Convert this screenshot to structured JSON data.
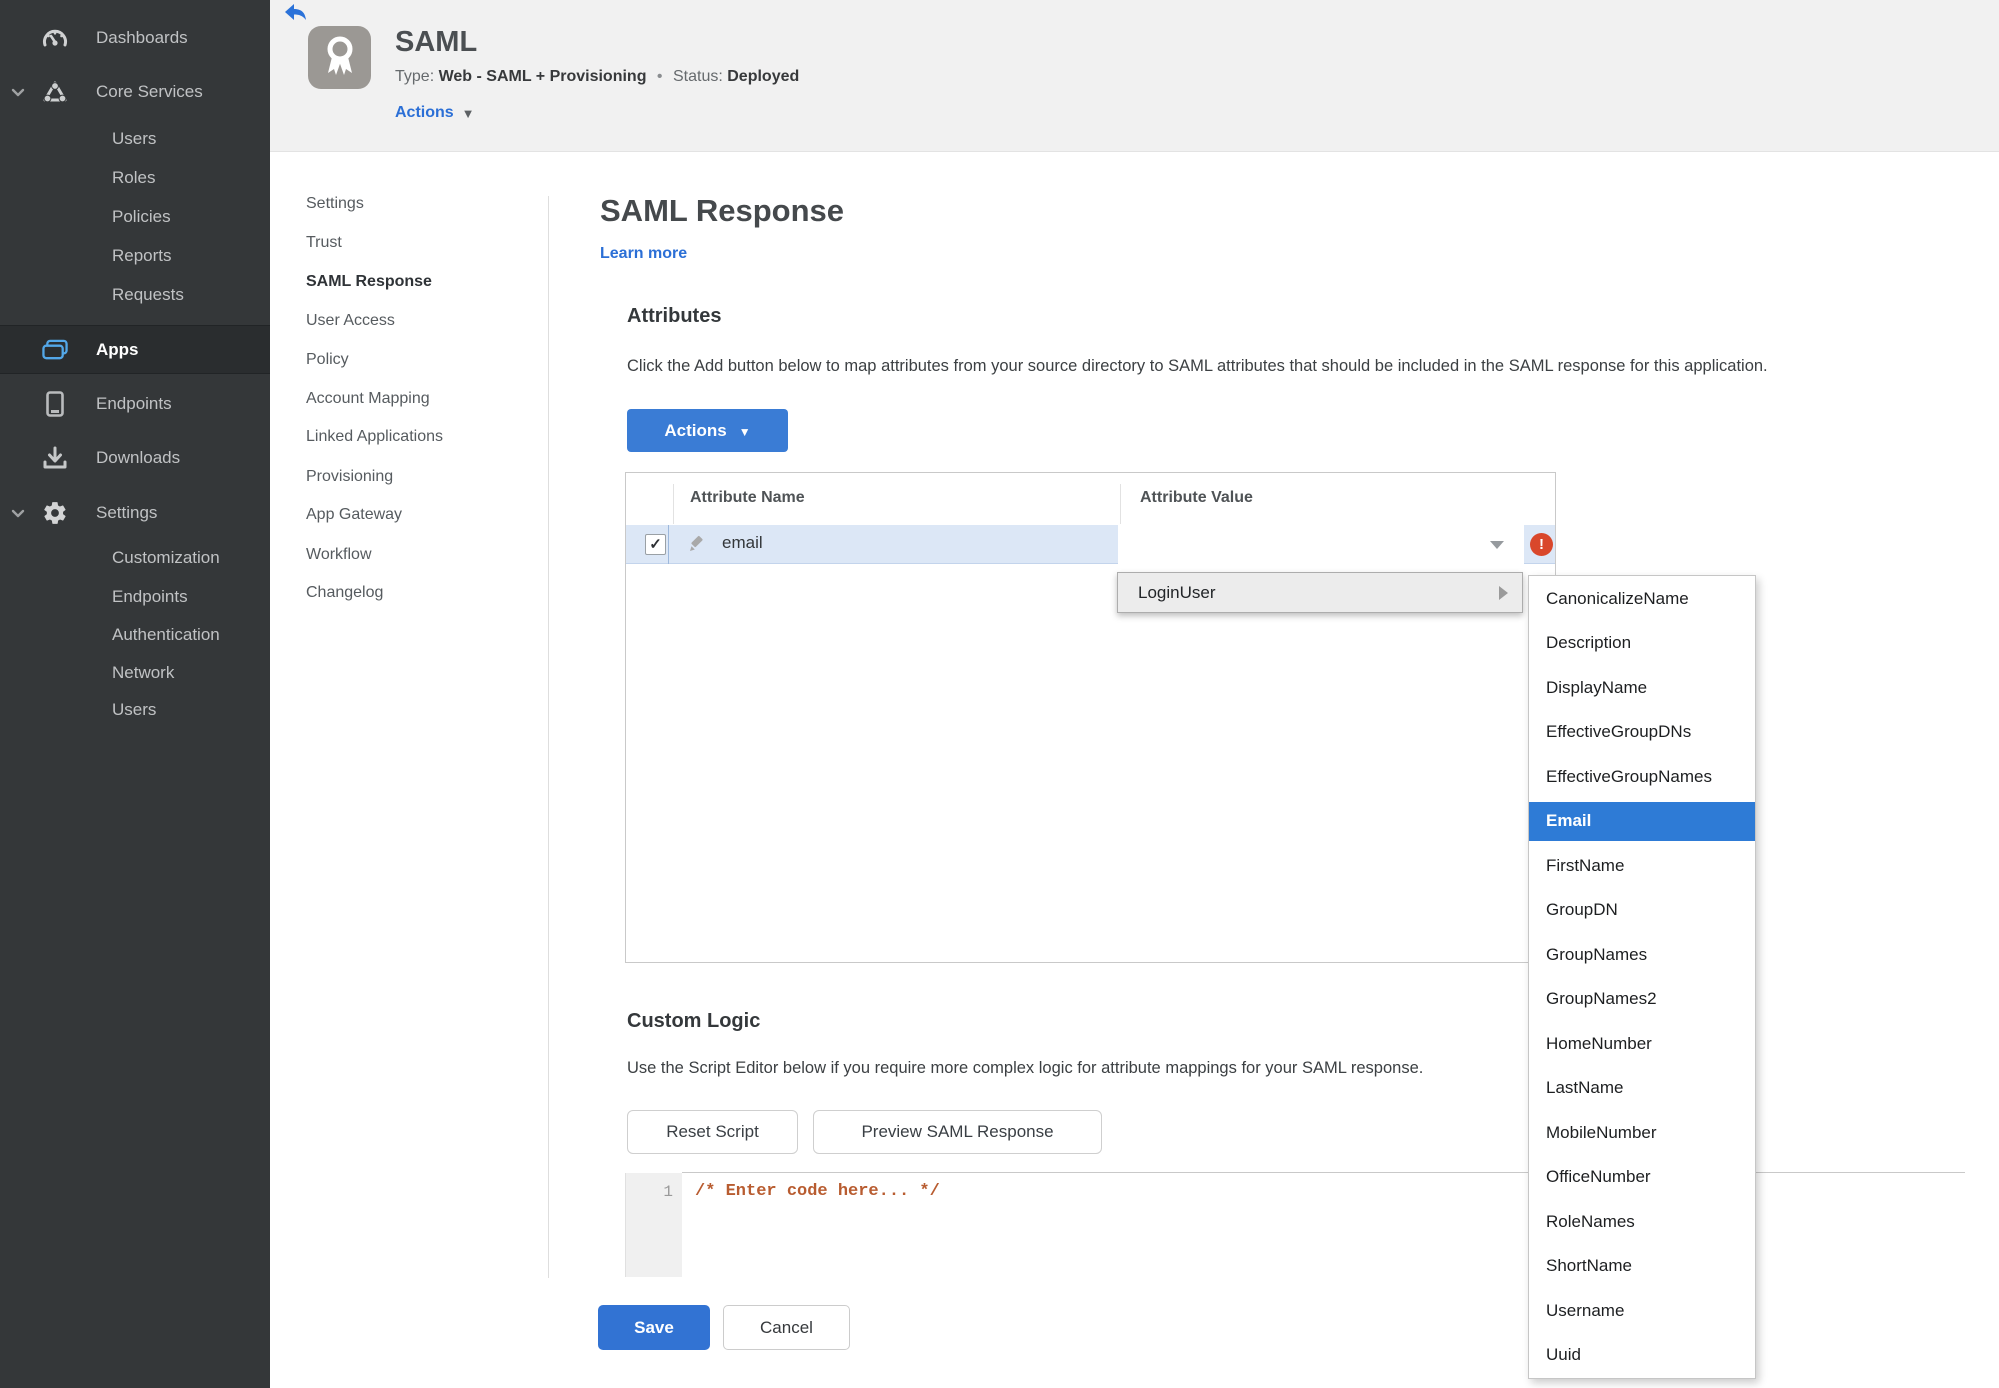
{
  "sidebar": {
    "items": [
      {
        "label": "Dashboards"
      },
      {
        "label": "Core Services"
      },
      {
        "label": "Users"
      },
      {
        "label": "Roles"
      },
      {
        "label": "Policies"
      },
      {
        "label": "Reports"
      },
      {
        "label": "Requests"
      },
      {
        "label": "Apps"
      },
      {
        "label": "Endpoints"
      },
      {
        "label": "Downloads"
      },
      {
        "label": "Settings"
      },
      {
        "label": "Customization"
      },
      {
        "label": "Endpoints"
      },
      {
        "label": "Authentication"
      },
      {
        "label": "Network"
      },
      {
        "label": "Users"
      }
    ]
  },
  "header": {
    "app_title": "SAML",
    "type_label": "Type:",
    "type_value": "Web - SAML + Provisioning",
    "separator": "•",
    "status_label": "Status:",
    "status_value": "Deployed",
    "actions_label": "Actions"
  },
  "nav": {
    "items": [
      {
        "label": "Settings"
      },
      {
        "label": "Trust"
      },
      {
        "label": "SAML Response"
      },
      {
        "label": "User Access"
      },
      {
        "label": "Policy"
      },
      {
        "label": "Account Mapping"
      },
      {
        "label": "Linked Applications"
      },
      {
        "label": "Provisioning"
      },
      {
        "label": "App Gateway"
      },
      {
        "label": "Workflow"
      },
      {
        "label": "Changelog"
      }
    ],
    "active": "SAML Response"
  },
  "main": {
    "title": "SAML Response",
    "learn_more": "Learn more",
    "attributes": {
      "heading": "Attributes",
      "description": "Click the Add button below to map attributes from your source directory to SAML attributes that should be included in the SAML response for this application.",
      "actions_button": "Actions",
      "table": {
        "columns": [
          "Attribute Name",
          "Attribute Value"
        ],
        "rows": [
          {
            "name": "email",
            "value": "",
            "checked": true,
            "error": true
          }
        ]
      }
    },
    "custom_logic": {
      "heading": "Custom Logic",
      "description": "Use the Script Editor below if you require more complex logic for attribute mappings for your SAML response.",
      "reset_button": "Reset Script",
      "preview_button": "Preview SAML Response",
      "editor": {
        "line_number": "1",
        "code": "/* Enter code here... */"
      }
    },
    "save_button": "Save",
    "cancel_button": "Cancel"
  },
  "dropdown": {
    "menu_label": "LoginUser",
    "submenu": {
      "items": [
        "CanonicalizeName",
        "Description",
        "DisplayName",
        "EffectiveGroupDNs",
        "EffectiveGroupNames",
        "Email",
        "FirstName",
        "GroupDN",
        "GroupNames",
        "GroupNames2",
        "HomeNumber",
        "LastName",
        "MobileNumber",
        "OfficeNumber",
        "RoleNames",
        "ShortName",
        "Username",
        "Uuid"
      ],
      "selected": "Email"
    }
  },
  "icons": {
    "caret_down": "▼",
    "check": "✓",
    "error_mark": "!"
  },
  "colors": {
    "accent_blue": "#3a7cd5",
    "selected_blue": "#2e7bd6",
    "link_blue": "#2b6fd6",
    "status_green": "#44941f",
    "error_red": "#d9472b",
    "row_highlight": "#dce7f6",
    "sidebar_bg": "#343739"
  }
}
